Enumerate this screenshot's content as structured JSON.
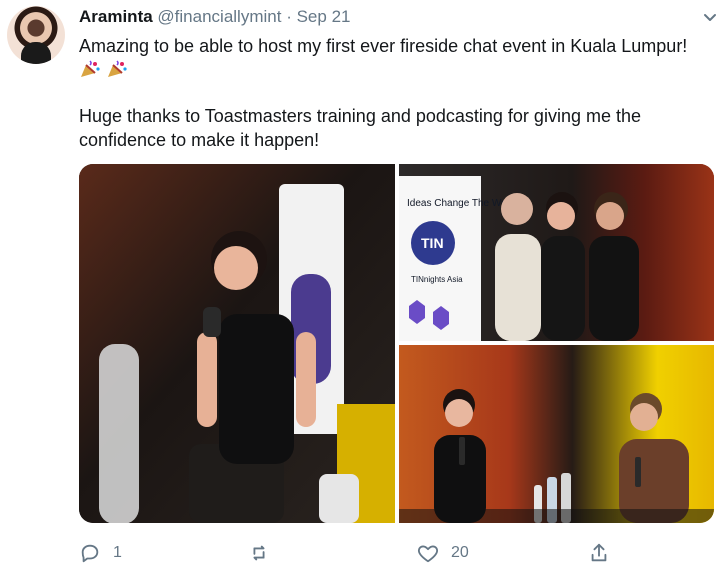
{
  "tweet": {
    "author_name": "Araminta",
    "handle": "@financiallymint",
    "separator": "·",
    "date": "Sep 21",
    "text_line1": "Amazing to be able to host my first ever fireside chat event in Kuala Lumpur!",
    "text_para2": "Huge thanks to Toastmasters training and podcasting for giving me the confidence to make it happen!",
    "emojis": [
      "party-popper-icon",
      "party-popper-icon"
    ]
  },
  "media": {
    "photos": [
      {
        "label": "speaker-with-microphone"
      },
      {
        "label": "three-people-posing-with-banner"
      },
      {
        "label": "fireside-chat-stage"
      }
    ],
    "banner_text_1": "Ideas Change The World",
    "banner_logo": "TIN",
    "banner_text_2": "TINnights Asia"
  },
  "actions": {
    "reply_count": "1",
    "retweet_count": "",
    "like_count": "20",
    "share_count": ""
  },
  "colors": {
    "text_primary": "#14171a",
    "text_secondary": "#657786",
    "background": "#ffffff"
  }
}
